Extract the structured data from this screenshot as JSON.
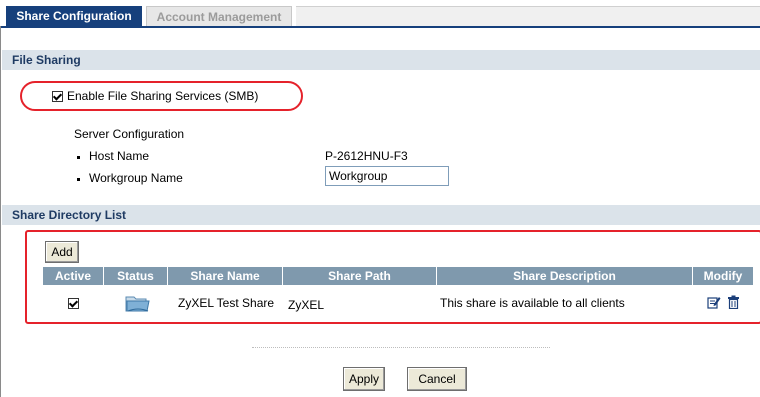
{
  "tabs": [
    {
      "label": "Share Configuration",
      "active": true
    },
    {
      "label": "Account Management",
      "active": false
    }
  ],
  "file_sharing": {
    "section_title": "File Sharing",
    "enable_label": "Enable File Sharing Services (SMB)",
    "enable_checked": true,
    "server_config_title": "Server Configuration",
    "host_name_label": "Host Name",
    "host_name_value": "P-2612HNU-F3",
    "workgroup_label": "Workgroup Name",
    "workgroup_value": "Workgroup"
  },
  "share_list": {
    "section_title": "Share Directory List",
    "add_label": "Add",
    "columns": [
      "Active",
      "Status",
      "Share Name",
      "Share Path",
      "Share Description",
      "Modify"
    ],
    "rows": [
      {
        "active": true,
        "status_icon": "shared-folder-icon",
        "name": "ZyXEL Test Share",
        "path": "ZyXEL",
        "description": "This share is available to all clients",
        "modify_icons": [
          "edit-icon",
          "trash-icon"
        ]
      }
    ]
  },
  "actions": {
    "apply_label": "Apply",
    "cancel_label": "Cancel"
  },
  "colors": {
    "tab_active": "#16407c",
    "section_bg": "#dbe3ea",
    "table_header": "#7f99ad",
    "highlight_red": "#e5222b"
  }
}
